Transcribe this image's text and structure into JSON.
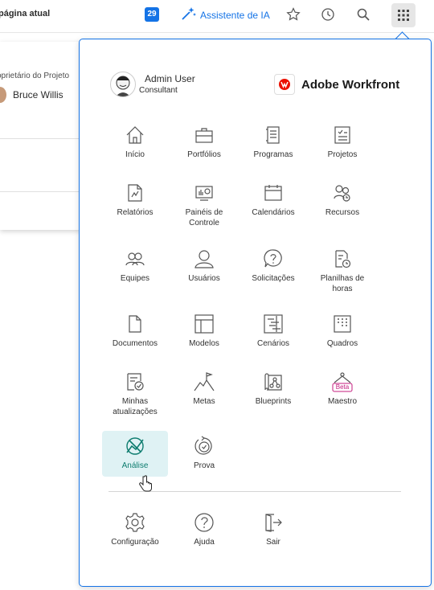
{
  "topbar": {
    "breadcrumb": "página atual",
    "badge_count": "29",
    "ai_label": "Assistente de IA",
    "icons": [
      "sparkle-icon",
      "star-icon",
      "history-icon",
      "search-icon",
      "app-grid-icon"
    ]
  },
  "background": {
    "owner_label": "oprietário do Projeto",
    "owner_name": "Bruce Willis"
  },
  "menu": {
    "user_name": "Admin User",
    "user_role": "Consultant",
    "brand": "Adobe Workfront",
    "accent_color": "#1473e6",
    "items": [
      {
        "label": "Início",
        "icon": "home-icon"
      },
      {
        "label": "Portfólios",
        "icon": "briefcase-icon"
      },
      {
        "label": "Programas",
        "icon": "program-icon"
      },
      {
        "label": "Projetos",
        "icon": "project-icon"
      },
      {
        "label": "Relatórios",
        "icon": "report-icon"
      },
      {
        "label": "Painéis de Controle",
        "icon": "dashboard-icon"
      },
      {
        "label": "Calendários",
        "icon": "calendar-icon"
      },
      {
        "label": "Recursos",
        "icon": "resources-icon"
      },
      {
        "label": "Equipes",
        "icon": "teams-icon"
      },
      {
        "label": "Usuários",
        "icon": "user-icon"
      },
      {
        "label": "Solicitações",
        "icon": "request-icon"
      },
      {
        "label": "Planilhas de horas",
        "icon": "timesheet-icon"
      },
      {
        "label": "Documentos",
        "icon": "document-icon"
      },
      {
        "label": "Modelos",
        "icon": "template-icon"
      },
      {
        "label": "Cenários",
        "icon": "scenario-icon"
      },
      {
        "label": "Quadros",
        "icon": "board-icon"
      },
      {
        "label": "Minhas atualizações",
        "icon": "updates-icon"
      },
      {
        "label": "Metas",
        "icon": "goals-icon"
      },
      {
        "label": "Blueprints",
        "icon": "blueprint-icon"
      },
      {
        "label": "Maestro",
        "icon": "maestro-icon",
        "tag": "Beta"
      },
      {
        "label": "Análise",
        "icon": "analytics-icon",
        "active": true
      },
      {
        "label": "Prova",
        "icon": "proof-icon"
      },
      {
        "label": "Configuração",
        "icon": "gear-icon"
      },
      {
        "label": "Ajuda",
        "icon": "help-icon"
      },
      {
        "label": "Sair",
        "icon": "exit-icon"
      }
    ]
  }
}
